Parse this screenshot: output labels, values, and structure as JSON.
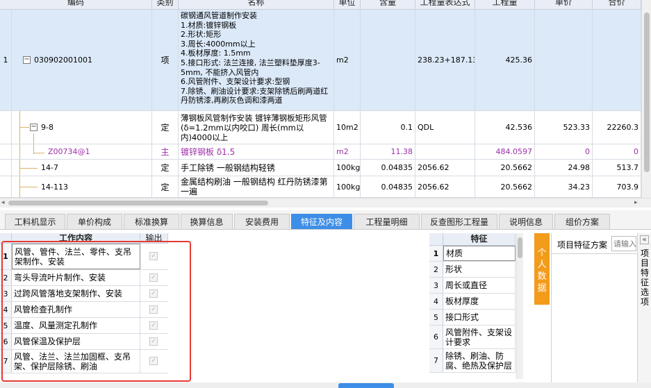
{
  "grid": {
    "headers": [
      "编码",
      "类别",
      "名称",
      "单位",
      "含量",
      "工程量表达式",
      "工程量",
      "单价",
      "合价"
    ],
    "rows": [
      {
        "num": "1",
        "code": "030902001001",
        "cat": "项",
        "name": "碳钢通风管道制作安装\n1.材质:镀锌钢板\n2.形状:矩形\n3.周长:4000mm以上\n4.板材厚度: 1.5mm\n5.接口形式: 法兰连接, 法兰塑料垫厚度3-5mm, 不能挤入风管内\n6.风管附件、支架设计要求:型钢\n7.除锈、刷油设计要求:支架除锈后刷两道红丹防锈漆,再刷灰色调和漆两道",
        "unit": "m2",
        "content": "",
        "expr": "238.23+187.13",
        "qty": "425.36",
        "price": "",
        "total": ""
      },
      {
        "num": "",
        "code": "9-8",
        "cat": "定",
        "name": "薄钢板风管制作安装 镀锌薄钢板矩形风管 (δ=1.2mm以内咬口) 周长(mm以内)4000以上",
        "unit": "10m2",
        "content": "0.1",
        "expr": "QDL",
        "qty": "42.536",
        "price": "523.33",
        "total": "22260.3"
      },
      {
        "num": "",
        "code": "Z00734@1",
        "cat": "主",
        "name": "镀锌钢板 δ1.5",
        "unit": "m2",
        "content": "11.38",
        "expr": "",
        "qty": "484.0597",
        "price": "0",
        "total": "0"
      },
      {
        "num": "",
        "code": "14-7",
        "cat": "定",
        "name": "手工除锈 一般钢结构轻锈",
        "unit": "100kg",
        "content": "0.04835",
        "expr": "2056.62",
        "qty": "20.5662",
        "price": "24.98",
        "total": "513.7"
      },
      {
        "num": "",
        "code": "14-113",
        "cat": "定",
        "name": "金属结构刷油 一般钢结构 红丹防锈漆第一遍",
        "unit": "100kg",
        "content": "0.04835",
        "expr": "2056.62",
        "qty": "20.5662",
        "price": "34.23",
        "total": "703.9"
      }
    ]
  },
  "tabs": [
    "工料机显示",
    "单价构成",
    "标准换算",
    "换算信息",
    "安装费用",
    "特征及内容",
    "工程量明细",
    "反查图形工程量",
    "说明信息",
    "组价方案"
  ],
  "active_tab": "特征及内容",
  "work": {
    "header": "工作内容",
    "output_header": "输出",
    "items": [
      {
        "num": "1",
        "text": "风管、管件、法兰、零件、支吊架制作、安装"
      },
      {
        "num": "2",
        "text": "弯头导流叶片制作、安装"
      },
      {
        "num": "3",
        "text": "过跨风管落地支架制作、安装"
      },
      {
        "num": "4",
        "text": "风管检查孔制作"
      },
      {
        "num": "5",
        "text": "温度、风量测定孔制作"
      },
      {
        "num": "6",
        "text": "风管保温及保护层"
      },
      {
        "num": "7",
        "text": "风管、法兰、法兰加固框、支吊架、保护层除锈、刷油"
      }
    ]
  },
  "features": {
    "header": "特征",
    "items": [
      {
        "num": "1",
        "text": "材质"
      },
      {
        "num": "2",
        "text": "形状"
      },
      {
        "num": "3",
        "text": "周长或直径"
      },
      {
        "num": "4",
        "text": "板材厚度"
      },
      {
        "num": "5",
        "text": "接口形式"
      },
      {
        "num": "6",
        "text": "风管附件、支架设计要求"
      },
      {
        "num": "7",
        "text": "除锈、刷油、防腐、绝热及保护层"
      }
    ]
  },
  "personal_data_label": "个人数据",
  "feature_scheme_label": "项目特征方案",
  "scheme_input_placeholder": "请输入",
  "side_tab_label": "项目特征选项",
  "collapse_icon": "«"
}
